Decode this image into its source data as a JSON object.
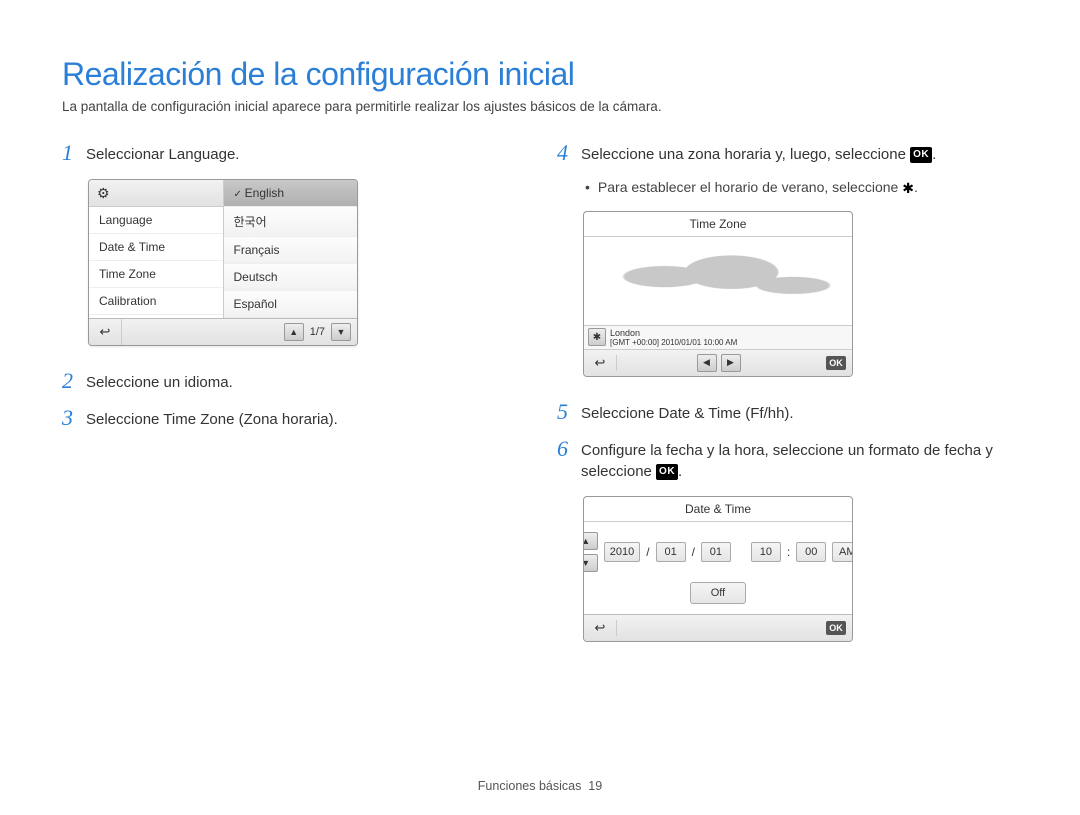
{
  "title": "Realización de la configuración inicial",
  "subtitle": "La pantalla de configuración inicial aparece para permitirle realizar los ajustes básicos de la cámara.",
  "steps": {
    "s1": "Seleccionar Language.",
    "s2": "Seleccione un idioma.",
    "s3": "Seleccione Time Zone (Zona horaria).",
    "s4_pre": "Seleccione una zona horaria y, luego, seleccione ",
    "s4_post": ".",
    "s4_bullet_pre": "Para establecer el horario de verano, seleccione ",
    "s4_bullet_post": ".",
    "s5": "Seleccione Date & Time (Ff/hh).",
    "s6_pre": "Configure la fecha y la hora, seleccione un formato de fecha y seleccione ",
    "s6_post": "."
  },
  "ok_label": "OK",
  "lang_device": {
    "menu": [
      "Language",
      "Date & Time",
      "Time Zone",
      "Calibration"
    ],
    "langs": [
      "English",
      "한국어",
      "Français",
      "Deutsch",
      "Español"
    ],
    "page": "1/7"
  },
  "tz_device": {
    "title": "Time Zone",
    "city": "London",
    "detail": "[GMT +00:00] 2010/01/01 10:00 AM"
  },
  "dt_device": {
    "title": "Date & Time",
    "year": "2010",
    "m": "01",
    "d": "01",
    "h": "10",
    "min": "00",
    "ampm": "AM",
    "sep_date": "/",
    "sep_time": ":",
    "off": "Off"
  },
  "footer_section": "Funciones básicas",
  "footer_page": "19"
}
